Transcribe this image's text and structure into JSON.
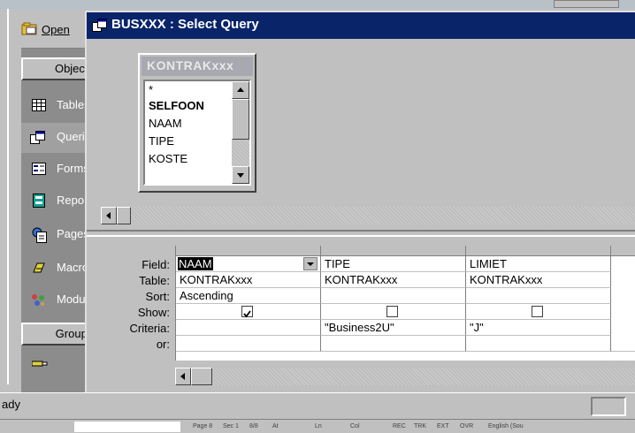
{
  "db_window": {
    "open_label": "Open",
    "objects_header": "Objects",
    "groups_header": "Groups",
    "nav_items": [
      {
        "label": "Tables",
        "icon": "table-icon"
      },
      {
        "label": "Queries",
        "icon": "query-icon"
      },
      {
        "label": "Forms",
        "icon": "form-icon"
      },
      {
        "label": "Reports",
        "icon": "report-icon"
      },
      {
        "label": "Pages",
        "icon": "page-icon"
      },
      {
        "label": "Macros",
        "icon": "macro-icon"
      },
      {
        "label": "Modules",
        "icon": "module-icon"
      }
    ]
  },
  "query_window": {
    "title": "BUSXXX : Select Query",
    "title_color": "#0a246a",
    "field_list": {
      "table_name": "KONTRAKxxx",
      "fields": [
        {
          "name": "*",
          "bold": false
        },
        {
          "name": "SELFOON",
          "bold": true
        },
        {
          "name": "NAAM",
          "bold": false
        },
        {
          "name": "TIPE",
          "bold": false
        },
        {
          "name": "KOSTE",
          "bold": false
        }
      ]
    },
    "grid": {
      "row_labels": {
        "field": "Field:",
        "table": "Table:",
        "sort": "Sort:",
        "show": "Show:",
        "criteria": "Criteria:",
        "or": "or:"
      },
      "columns": [
        {
          "field": "NAAM",
          "table": "KONTRAKxxx",
          "sort": "Ascending",
          "show": true,
          "criteria": "",
          "or": ""
        },
        {
          "field": "TIPE",
          "table": "KONTRAKxxx",
          "sort": "",
          "show": false,
          "criteria": "\"Business2U\"",
          "or": ""
        },
        {
          "field": "LIMIET",
          "table": "KONTRAKxxx",
          "sort": "",
          "show": false,
          "criteria": "\"J\"",
          "or": ""
        }
      ]
    }
  },
  "status_bar": {
    "text": "ady"
  },
  "taskbar": {
    "items": [
      "Page 8",
      "Sec 1",
      "8/8",
      "At",
      "Ln",
      "Col",
      "REC",
      "TRK",
      "EXT",
      "OVR",
      "English (Sou"
    ]
  }
}
